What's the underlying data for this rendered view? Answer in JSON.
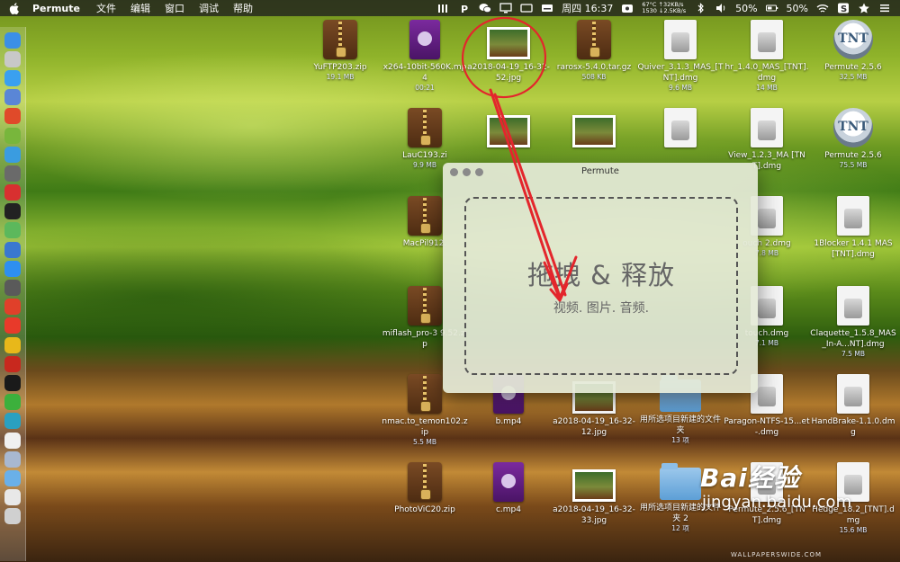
{
  "menubar": {
    "app_name": "Permute",
    "menus": [
      "文件",
      "编辑",
      "窗口",
      "调试",
      "帮助"
    ],
    "day_time": "周四 16:37",
    "temp": "67°C",
    "net_up": "↑32KB/s",
    "fan": "1530",
    "net_down": "↓2.5KB/s",
    "volume": "50%",
    "battery": "50%"
  },
  "dock": {
    "apps": [
      {
        "name": "finder",
        "color": "#3b8fe6"
      },
      {
        "name": "launchpad",
        "color": "#c8c8c8"
      },
      {
        "name": "safari",
        "color": "#3aa0f0"
      },
      {
        "name": "preview",
        "color": "#5a86d6"
      },
      {
        "name": "app-red",
        "color": "#e04a2a"
      },
      {
        "name": "android",
        "color": "#78b63c"
      },
      {
        "name": "migration",
        "color": "#3a9ce0"
      },
      {
        "name": "settings-gear",
        "color": "#6a6a6a"
      },
      {
        "name": "app-red-2",
        "color": "#d83030"
      },
      {
        "name": "terminal",
        "color": "#222222"
      },
      {
        "name": "maps",
        "color": "#5cb85c"
      },
      {
        "name": "app-blue",
        "color": "#3a78d0"
      },
      {
        "name": "app-store",
        "color": "#2e8ff0"
      },
      {
        "name": "app-gray",
        "color": "#5a5a5a"
      },
      {
        "name": "weibo",
        "color": "#e0402a"
      },
      {
        "name": "yandex",
        "color": "#e83a2a"
      },
      {
        "name": "chrome",
        "color": "#e8b81a"
      },
      {
        "name": "vivaldi",
        "color": "#c8281e"
      },
      {
        "name": "terminal-2",
        "color": "#1a1a1a"
      },
      {
        "name": "wechat",
        "color": "#3cb03c"
      },
      {
        "name": "app-teal",
        "color": "#2aa0c0"
      },
      {
        "name": "textedit",
        "color": "#f0f0f0"
      },
      {
        "name": "app-box",
        "color": "#a8b8d0"
      },
      {
        "name": "downloads-folder",
        "color": "#6ab0e8"
      },
      {
        "name": "app-light",
        "color": "#e8e8e8"
      },
      {
        "name": "trash",
        "color": "#d0d0d0"
      }
    ]
  },
  "desktop": [
    {
      "id": "yuftp",
      "type": "zip",
      "name": "YuFTP203.zip",
      "meta": "19.1 MB"
    },
    {
      "id": "x264",
      "type": "mp4",
      "name": "x264-10bit-560K.mp4",
      "meta": "00:21"
    },
    {
      "id": "jpg1",
      "type": "jpg",
      "name": "a2018-04-19_16-32-52.jpg",
      "meta": ""
    },
    {
      "id": "rarosx",
      "type": "zip",
      "name": "rarosx-5.4.0.tar.gz",
      "meta": "508 KB"
    },
    {
      "id": "quiver",
      "type": "dmg",
      "name": "Quiver_3.1.3_MAS_[TNT].dmg",
      "meta": "9.6 MB"
    },
    {
      "id": "hr",
      "type": "dmg",
      "name": "hr_1.4.0_MAS_[TNT].dmg",
      "meta": "14 MB"
    },
    {
      "id": "permute1",
      "type": "tnt",
      "name": "Permute 2.5.6",
      "meta": "32.5 MB"
    },
    {
      "id": "laucl",
      "type": "zip",
      "name": "LauC193.zi",
      "meta": "9.9 MB"
    },
    {
      "id": "jpg2",
      "type": "jpg",
      "name": "",
      "meta": ""
    },
    {
      "id": "jpg3",
      "type": "jpg",
      "name": "",
      "meta": ""
    },
    {
      "id": "dmg2",
      "type": "dmg",
      "name": "",
      "meta": ""
    },
    {
      "id": "view",
      "type": "dmg",
      "name": "View_1.2.3_MA [TNT].dmg",
      "meta": ""
    },
    {
      "id": "permute2",
      "type": "tnt",
      "name": "Permute 2.5.6",
      "meta": "75.5 MB"
    },
    {
      "id": "macpil",
      "type": "zip",
      "name": "MacPil912.",
      "meta": ""
    },
    {
      "id": "touch2",
      "type": "dmg",
      "name": "ouch 2.dmg",
      "meta": "7.8 MB"
    },
    {
      "id": "1blocker",
      "type": "dmg",
      "name": "1Blocker 1.4.1 MAS [TNT].dmg",
      "meta": ""
    },
    {
      "id": "miflash",
      "type": "zip",
      "name": "miflash_pro-3 9.52.zip",
      "meta": ""
    },
    {
      "id": "touch",
      "type": "dmg",
      "name": "touch.dmg",
      "meta": "7.1 MB"
    },
    {
      "id": "claquette",
      "type": "dmg",
      "name": "Claquette_1.5.8_MAS_In-A...NT].dmg",
      "meta": "7.5 MB"
    },
    {
      "id": "nmac",
      "type": "zip",
      "name": "nmac.to_temon102.zip",
      "meta": "5.5 MB"
    },
    {
      "id": "bmp4",
      "type": "mp4",
      "name": "b.mp4",
      "meta": ""
    },
    {
      "id": "jpg4",
      "type": "jpg",
      "name": "a2018-04-19_16-32-12.jpg",
      "meta": ""
    },
    {
      "id": "folder1",
      "type": "folder",
      "name": "用所选项目新建的文件夹",
      "meta": "13 项"
    },
    {
      "id": "paragon",
      "type": "dmg",
      "name": "Paragon-NTFS-15...et-.dmg",
      "meta": ""
    },
    {
      "id": "handbrake",
      "type": "dmg",
      "name": "HandBrake-1.1.0.dmg",
      "meta": ""
    },
    {
      "id": "photovic",
      "type": "zip",
      "name": "PhotoViC20.zip",
      "meta": ""
    },
    {
      "id": "cmp4",
      "type": "mp4",
      "name": "c.mp4",
      "meta": ""
    },
    {
      "id": "jpg5",
      "type": "jpg",
      "name": "a2018-04-19_16-32-33.jpg",
      "meta": ""
    },
    {
      "id": "folder2",
      "type": "folder",
      "name": "用所选项目新建的文件夹 2",
      "meta": "12 项"
    },
    {
      "id": "permute-tnt",
      "type": "dmg",
      "name": "Permute_2.5.6_[TNT].dmg",
      "meta": ""
    },
    {
      "id": "hedge",
      "type": "dmg",
      "name": "Hedge_18.2_[TNT].dmg",
      "meta": "15.6 MB"
    }
  ],
  "window": {
    "title": "Permute",
    "drop_title": "拖拽 & 释放",
    "drop_subtitle": "视频. 图片. 音频."
  },
  "watermark": {
    "brand": "Bai经验",
    "url": "jingyan.baidu.com",
    "credit": "WALLPAPERSWIDE.COM"
  }
}
